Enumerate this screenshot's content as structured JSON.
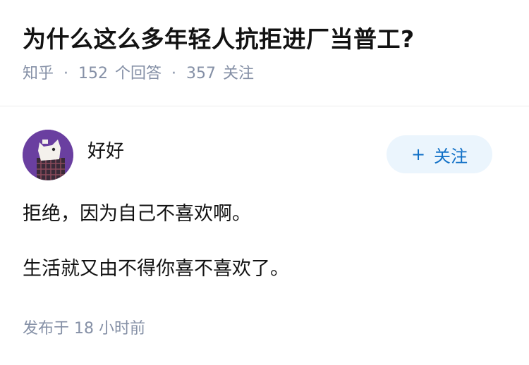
{
  "question": {
    "title": "为什么这么多年轻人抗拒进厂当普工?",
    "source": "知乎",
    "separator": "·",
    "answer_count": "152",
    "answer_label": "个回答",
    "follower_count": "357",
    "follower_label": "关注"
  },
  "author": {
    "name": "好好",
    "avatar_icon": "cartoon-avatar-icon",
    "follow_button_plus": "+",
    "follow_button_label": "关注"
  },
  "answer": {
    "paragraphs": [
      "拒绝，因为自己不喜欢啊。",
      "生活就又由不得你喜不喜欢了。"
    ],
    "publish_time": "发布于  18 小时前"
  },
  "colors": {
    "title": "#121212",
    "meta": "#8590a6",
    "follow_button_bg": "#ebf5fd",
    "follow_button_text": "#0f6fc6",
    "avatar_bg": "#6a3fa0"
  }
}
